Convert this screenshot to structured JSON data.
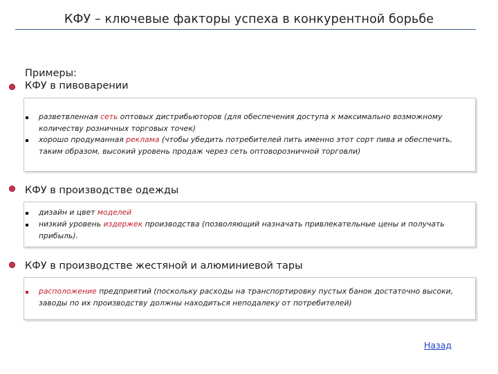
{
  "slide": {
    "title": "КФУ – ключевые факторы успеха в конкурентной борьбе"
  },
  "intro": {
    "line1": "Примеры:"
  },
  "sections": [
    {
      "heading": "КФУ в пивоварении",
      "items": [
        {
          "before": "разветвленная ",
          "highlight": "сеть",
          "after": " оптовых дистрибьюторов (для обеспечения доступа к максимально возможному количеству розничных торговых точек)"
        },
        {
          "before": "хорошо продуманная ",
          "highlight": "реклама",
          "after": " (чтобы убедить потребителей пить именно этот сорт пива и обеспечить, таким образом, высокий уровень продаж через сеть оптоворозничной торговли)"
        }
      ]
    },
    {
      "heading": "КФУ в производстве одежды",
      "items": [
        {
          "before": "дизайн и цвет ",
          "highlight": "моделей",
          "after": ""
        },
        {
          "before": "низкий уровень ",
          "highlight": "издержек",
          "after": " производства (позволяющий назначать привлекательные цены и получать прибыль)."
        }
      ]
    },
    {
      "heading": "КФУ в производстве жестяной и алюминиевой тары",
      "items": [
        {
          "before": "",
          "highlight": "расположение",
          "after": " предприятий (поскольку расходы на транспортировку пустых банок достаточно высоки, заводы по их производству должны находиться неподалеку от потребителей)"
        }
      ]
    }
  ],
  "nav": {
    "back_label": "Назад"
  },
  "colors": {
    "accent_red": "#c0202e",
    "title_rule": "#3c5a82",
    "link": "#1a3fc8"
  }
}
